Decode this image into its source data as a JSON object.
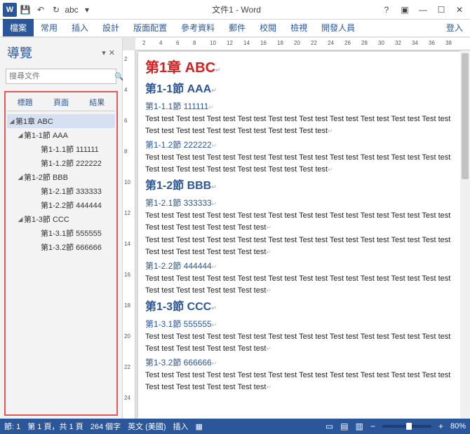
{
  "titlebar": {
    "qat_abc": "abc",
    "doc_title": "文件1 - Word"
  },
  "ribbon": {
    "file": "檔案",
    "tabs": [
      "常用",
      "插入",
      "設計",
      "版面配置",
      "參考資料",
      "郵件",
      "校閱",
      "檢視",
      "開發人員"
    ],
    "signin": "登入"
  },
  "nav": {
    "title": "導覽",
    "search_placeholder": "搜尋文件",
    "tabs": [
      "標題",
      "頁面",
      "結果"
    ],
    "tree": [
      {
        "lvl": 1,
        "has_children": true,
        "text": "第1章 ABC",
        "sel": true
      },
      {
        "lvl": 2,
        "has_children": true,
        "text": "第1-1節 AAA"
      },
      {
        "lvl": 3,
        "text": "第1-1.1節 111111"
      },
      {
        "lvl": 3,
        "text": "第1-1.2節 222222"
      },
      {
        "lvl": 2,
        "has_children": true,
        "text": "第1-2節 BBB"
      },
      {
        "lvl": 3,
        "text": "第1-2.1節 333333"
      },
      {
        "lvl": 3,
        "text": "第1-2.2節 444444"
      },
      {
        "lvl": 2,
        "has_children": true,
        "text": "第1-3節 CCC"
      },
      {
        "lvl": 3,
        "text": "第1-3.1節 555555"
      },
      {
        "lvl": 3,
        "text": "第1-3.2節 666666"
      }
    ]
  },
  "hruler_ticks": [
    "2",
    "4",
    "6",
    "8",
    "10",
    "12",
    "14",
    "16",
    "18",
    "20",
    "22",
    "24",
    "26",
    "28",
    "30",
    "32",
    "34",
    "36",
    "38"
  ],
  "vruler_ticks": [
    "2",
    "4",
    "6",
    "8",
    "10",
    "12",
    "14",
    "16",
    "18",
    "20",
    "22",
    "24"
  ],
  "doc": {
    "h1": "第1章  ABC",
    "s11": {
      "h": "第1-1節  AAA",
      "h3a": "第1-1.1節 111111",
      "p": "Test test Test test Test test Test test Test test Test test Test test Test test Test test Test test Test test Test test Test test Test test Test test Test test",
      "h3b": "第1-1.2節 222222",
      "p2": "Test test Test test Test test Test test Test test Test test Test test Test test Test test Test test Test test Test test Test test Test test Test test Test test"
    },
    "s12": {
      "h": "第1-2節  BBB",
      "h3a": "第1-2.1節 333333",
      "p": "Test test Test test Test test Test test Test test Test test Test test Test test Test test Test test Test test Test test Test test Test test",
      "p2": "Test test Test test Test test Test test Test test Test test Test test Test test Test test Test test Test test Test test Test test Test test",
      "h3b": "第1-2.2節 444444",
      "p3": "Test test Test test Test test Test test Test test Test test Test test Test test Test test Test test Test test Test test Test test Test test"
    },
    "s13": {
      "h": "第1-3節  CCC",
      "h3a": "第1-3.1節 555555",
      "p": "Test test Test test Test test Test test Test test Test test Test test Test test Test test Test test Test test Test test Test test Test test",
      "h3b": "第1-3.2節 666666",
      "p2": "Test test Test test Test test Test test Test test Test test Test test Test test Test test Test test Test test Test test Test test Test test"
    }
  },
  "status": {
    "section": "節: 1",
    "page": "第 1 頁，共 1 頁",
    "words": "264 個字",
    "lang": "英文 (美國)",
    "mode": "插入",
    "zoom": "80%"
  }
}
